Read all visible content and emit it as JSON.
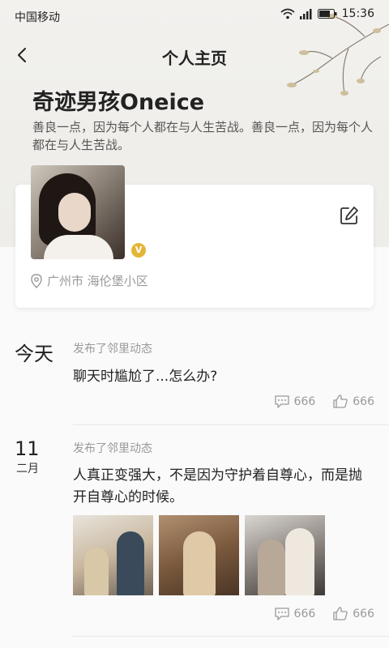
{
  "status_bar": {
    "carrier": "中国移动",
    "time": "15:36"
  },
  "nav": {
    "title": "个人主页"
  },
  "profile": {
    "name": "奇迹男孩Oneice",
    "bio": "善良一点，因为每个人都在与人生苦战。善良一点，因为每个人都在与人生苦战。",
    "badge": "V",
    "location": "广州市 海伦堡小区"
  },
  "feed": [
    {
      "date_big": "今天",
      "date_month": "",
      "action": "发布了邻里动态",
      "text": "聊天时尴尬了...怎么办?",
      "comments": "666",
      "likes": "666"
    },
    {
      "date_big": "11",
      "date_month": "二月",
      "action": "发布了邻里动态",
      "text": "人真正变强大，不是因为守护着自尊心，而是抛开自尊心的时候。",
      "comments": "666",
      "likes": "666"
    }
  ],
  "colors": {
    "accent_badge": "#e4b536",
    "muted_text": "#9a9a9a"
  },
  "icons": [
    "back-chevron-icon",
    "wifi-icon",
    "signal-icon",
    "battery-icon",
    "edit-icon",
    "location-pin-icon",
    "comment-icon",
    "thumbs-up-icon",
    "verified-badge-icon"
  ]
}
